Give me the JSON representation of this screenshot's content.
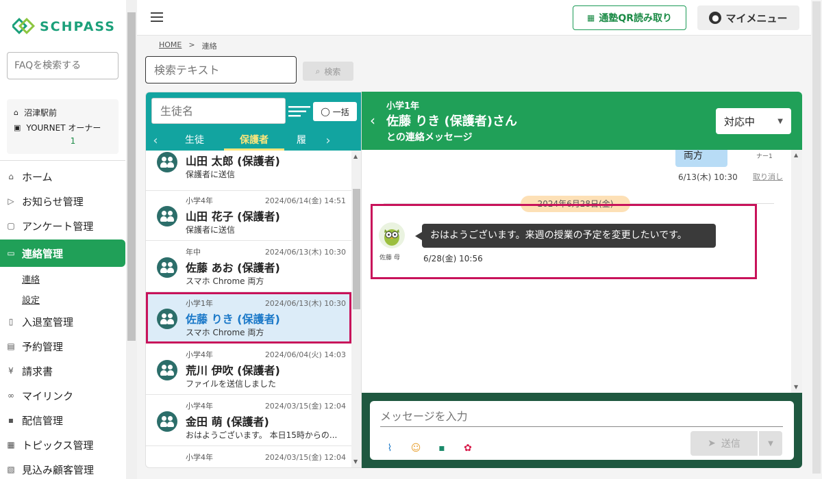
{
  "sidebar": {
    "logo": "SCHPASS",
    "faq_placeholder": "FAQを検索する",
    "school_name": "沼津駅前",
    "owner_name": "YOURNET オーナー",
    "owner_num": "1",
    "nav": [
      {
        "label": "ホーム",
        "icon": "home-icon"
      },
      {
        "label": "お知らせ管理",
        "icon": "play-icon"
      },
      {
        "label": "アンケート管理",
        "icon": "survey-icon"
      },
      {
        "label": "連絡管理",
        "icon": "chat-icon"
      },
      {
        "label": "入退室管理",
        "icon": "door-icon"
      },
      {
        "label": "予約管理",
        "icon": "calendar-icon"
      },
      {
        "label": "請求書",
        "icon": "yen-icon"
      },
      {
        "label": "マイリンク",
        "icon": "link-icon"
      },
      {
        "label": "配信管理",
        "icon": "delivery-icon"
      },
      {
        "label": "トピックス管理",
        "icon": "topics-icon"
      },
      {
        "label": "見込み顧客管理",
        "icon": "prospect-icon"
      }
    ],
    "sub_items": [
      "連絡",
      "設定"
    ]
  },
  "topbar": {
    "qr_label": "通塾QR読み取り",
    "my_menu_label": "マイメニュー"
  },
  "breadcrumb": {
    "home": "HOME",
    "sep": ">",
    "current": "連絡"
  },
  "search": {
    "placeholder": "検索テキスト",
    "button": "検索"
  },
  "list": {
    "name_placeholder": "生徒名",
    "bulk_label": "一括",
    "tabs": [
      "生徒",
      "保護者",
      "履"
    ],
    "active_tab": 1,
    "rows": [
      {
        "grade": "",
        "date": "",
        "name": "山田 太郎 (保護者)",
        "sub": "保護者に送信"
      },
      {
        "grade": "小学4年",
        "date": "2024/06/14(金) 14:51",
        "name": "山田 花子 (保護者)",
        "sub": "保護者に送信"
      },
      {
        "grade": "年中",
        "date": "2024/06/13(木) 10:30",
        "name": "佐藤 あお (保護者)",
        "sub": "スマホ Chrome 両方"
      },
      {
        "grade": "小学1年",
        "date": "2024/06/13(木) 10:30",
        "name": "佐藤 りき (保護者)",
        "sub": "スマホ Chrome 両方"
      },
      {
        "grade": "小学4年",
        "date": "2024/06/04(火) 14:03",
        "name": "荒川 伊吹 (保護者)",
        "sub": "ファイルを送信しました"
      },
      {
        "grade": "小学4年",
        "date": "2024/03/15(金) 12:04",
        "name": "金田 萌 (保護者)",
        "sub": "おはようございます。 本日15時からの..."
      },
      {
        "grade": "小学4年",
        "date": "2024/03/15(金) 12:04",
        "name": "",
        "sub": ""
      }
    ]
  },
  "chat": {
    "grade": "小学1年",
    "name": "佐藤 りき (保護者)さん",
    "subtitle": "との連絡メッセージ",
    "status": "対応中",
    "prev_bubble": "両方",
    "prev_reader": "ナー1",
    "prev_time": "6/13(木) 10:30",
    "prev_undo": "取り消し",
    "date_pill": "2024年6月28日(金)",
    "msg_avatar_name": "佐藤 母",
    "msg_text": "おはようございます。来週の授業の予定を変更したいです。",
    "msg_time": "6/28(金) 10:56",
    "compose_placeholder": "メッセージを入力",
    "send_label": "送信"
  },
  "colors": {
    "brand_green": "#20a058",
    "teal": "#12a4a0",
    "highlight": "#c8125a",
    "compose_bg": "#1f5840"
  }
}
